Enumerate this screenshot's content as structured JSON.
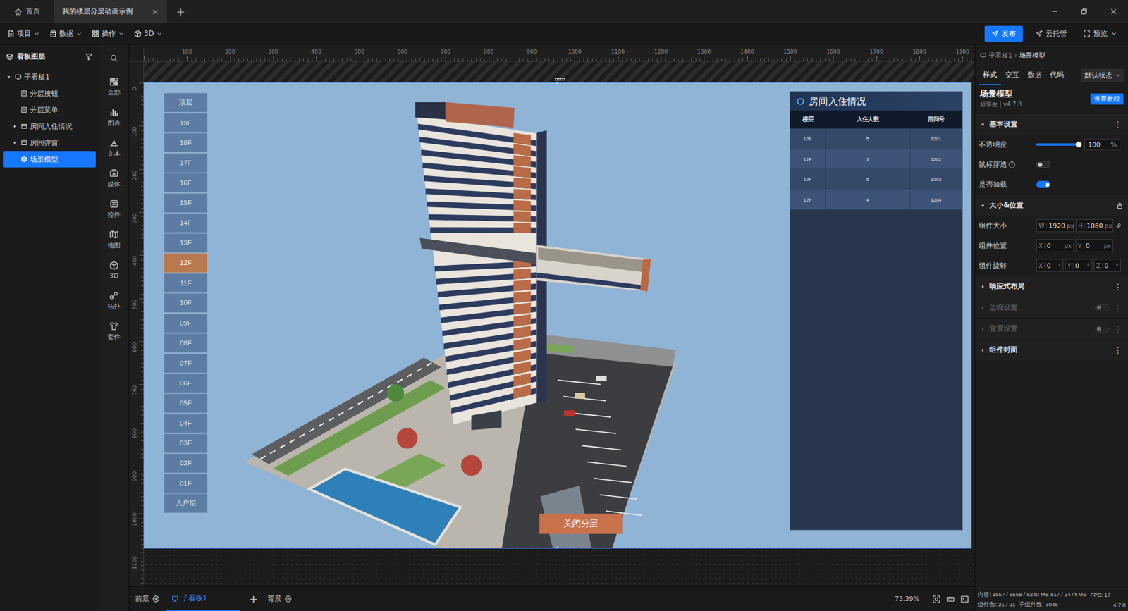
{
  "window": {
    "tabs": [
      {
        "label": "首页",
        "selected": false
      },
      {
        "label": "我的楼层分层动画示例",
        "selected": true,
        "close": "×"
      }
    ],
    "new_tab": "+"
  },
  "toolbar": {
    "menus": [
      {
        "label": "项目",
        "kind": "file"
      },
      {
        "label": "数据",
        "kind": "database"
      },
      {
        "label": "操作",
        "kind": "grid"
      },
      {
        "label": "3D",
        "kind": "cube"
      }
    ],
    "publish": "发布",
    "cloud": "云托管",
    "preview": "预览"
  },
  "layers": {
    "title": "看板图层",
    "items": [
      {
        "label": "子看板1",
        "kind": "board",
        "expanded": true,
        "selected": false,
        "children": [
          {
            "label": "分层按钮",
            "kind": "widget",
            "selected": false
          },
          {
            "label": "分层菜单",
            "kind": "widget",
            "selected": false
          },
          {
            "label": "房间入住情况",
            "kind": "group",
            "expanded": false,
            "selected": false
          },
          {
            "label": "房间弹窗",
            "kind": "group",
            "expanded": false,
            "selected": false
          },
          {
            "label": "场景模型",
            "kind": "model",
            "selected": true
          }
        ]
      }
    ]
  },
  "widgets": {
    "items": [
      {
        "label": "全部",
        "kind": "all"
      },
      {
        "label": "图表",
        "kind": "chart"
      },
      {
        "label": "文本",
        "kind": "text"
      },
      {
        "label": "媒体",
        "kind": "media"
      },
      {
        "label": "控件",
        "kind": "control"
      },
      {
        "label": "地图",
        "kind": "map"
      },
      {
        "label": "3D",
        "kind": "cube"
      },
      {
        "label": "拓扑",
        "kind": "topology"
      },
      {
        "label": "套件",
        "kind": "kit"
      }
    ]
  },
  "rulers": {
    "top": [
      "100",
      "200",
      "300",
      "400",
      "500",
      "600",
      "700",
      "800",
      "900",
      "1000",
      "1100",
      "1200",
      "1300",
      "1400",
      "1500",
      "1600",
      "1700",
      "1800",
      "1900"
    ],
    "left": [
      "0",
      "100",
      "200",
      "300",
      "400",
      "500",
      "600",
      "700",
      "800",
      "900",
      "1000",
      "1100"
    ]
  },
  "scene": {
    "floors": [
      {
        "label": "顶层",
        "selected": false
      },
      {
        "label": "19F",
        "selected": false
      },
      {
        "label": "18F",
        "selected": false
      },
      {
        "label": "17F",
        "selected": false
      },
      {
        "label": "16F",
        "selected": false
      },
      {
        "label": "15F",
        "selected": false
      },
      {
        "label": "14F",
        "selected": false
      },
      {
        "label": "13F",
        "selected": false
      },
      {
        "label": "12F",
        "selected": true
      },
      {
        "label": "11F",
        "selected": false
      },
      {
        "label": "10F",
        "selected": false
      },
      {
        "label": "09F",
        "selected": false
      },
      {
        "label": "08F",
        "selected": false
      },
      {
        "label": "07F",
        "selected": false
      },
      {
        "label": "06F",
        "selected": false
      },
      {
        "label": "05F",
        "selected": false
      },
      {
        "label": "04F",
        "selected": false
      },
      {
        "label": "03F",
        "selected": false
      },
      {
        "label": "02F",
        "selected": false
      },
      {
        "label": "01F",
        "selected": false
      },
      {
        "label": "入户层",
        "selected": false
      }
    ],
    "table": {
      "title": "房间入住情况",
      "columns": [
        "楼层",
        "入住人数",
        "房间号"
      ],
      "rows": [
        [
          "12F",
          "5",
          "1201"
        ],
        [
          "12F",
          "3",
          "1202"
        ],
        [
          "12F",
          "5",
          "1203"
        ],
        [
          "12F",
          "4",
          "1204"
        ]
      ]
    },
    "close_button": "关闭分层"
  },
  "bottom_bar": {
    "foreground": "前景",
    "boards": [
      {
        "label": "子看板1",
        "selected": true
      }
    ],
    "add_board": "+",
    "background": "背景",
    "zoom": "73.39%"
  },
  "inspector": {
    "breadcrumb": [
      "子看板1",
      "场景模型"
    ],
    "separator": "›",
    "tabs": [
      {
        "label": "样式",
        "selected": true
      },
      {
        "label": "交互",
        "selected": false
      },
      {
        "label": "数据",
        "selected": false
      },
      {
        "label": "代码",
        "selected": false
      }
    ],
    "state": "默认状态",
    "title": "场景模型",
    "subtitle": "鲸孪生 | v4.7.8",
    "tutorial": "查看教程",
    "sections": [
      {
        "title": "基本设置",
        "expanded": true,
        "disabled": false,
        "more": "⋮",
        "rows": [
          {
            "kind": "slider",
            "label": "不透明度",
            "level": 1,
            "value": "100",
            "unit": "%"
          },
          {
            "kind": "toggle",
            "label": "鼠标穿透",
            "help": "?",
            "on": false
          },
          {
            "kind": "toggle",
            "label": "是否加载",
            "on": true
          }
        ]
      },
      {
        "title": "大小&位置",
        "expanded": true,
        "disabled": false,
        "locked": true,
        "rows": [
          {
            "kind": "fields",
            "label": "组件大小",
            "linked": true,
            "fields": [
              {
                "axis": "W",
                "value": "1920",
                "unit": "px"
              },
              {
                "axis": "H",
                "value": "1080",
                "unit": "px"
              }
            ]
          },
          {
            "kind": "fields",
            "label": "组件位置",
            "fields": [
              {
                "axis": "X",
                "value": "0",
                "unit": "px"
              },
              {
                "axis": "Y",
                "value": "0",
                "unit": "px"
              }
            ]
          },
          {
            "kind": "fields",
            "label": "组件旋转",
            "fields": [
              {
                "axis": "X",
                "value": "0",
                "unit": "°"
              },
              {
                "axis": "Y",
                "value": "0",
                "unit": "°"
              },
              {
                "axis": "Z",
                "value": "0",
                "unit": "°"
              }
            ]
          }
        ]
      },
      {
        "title": "响应式布局",
        "expanded": false,
        "disabled": false,
        "more": "⋮"
      },
      {
        "title": "边框设置",
        "expanded": false,
        "disabled": true,
        "on": false,
        "more": "⋮"
      },
      {
        "title": "背景设置",
        "expanded": false,
        "disabled": true,
        "on": false,
        "more": "⋮"
      },
      {
        "title": "组件封面",
        "expanded": false,
        "disabled": false,
        "more": "⋮"
      }
    ]
  },
  "status_bar": {
    "memory": "内存: 1657 / 6568 / 8240 MB 817 / 2474 MB",
    "fps": "FPS: 17",
    "components": "组件数: 21 / 21",
    "children": "子组件数: 3048",
    "version": "4.7.8"
  }
}
